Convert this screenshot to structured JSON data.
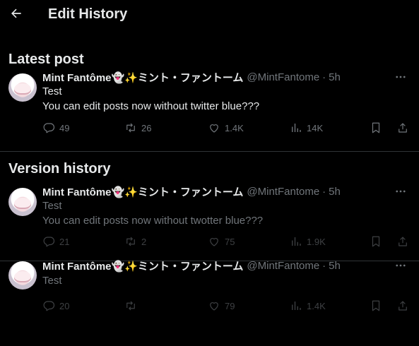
{
  "header": {
    "title": "Edit History"
  },
  "sections": {
    "latest": "Latest post",
    "version": "Version history"
  },
  "posts": [
    {
      "name": "Mint Fantôme👻✨ミント・ファントーム",
      "handle": "@MintFantome",
      "dot": "·",
      "time": "5h",
      "lines": [
        "Test",
        "You can edit posts now without twitter blue???"
      ],
      "replies": "49",
      "retweets": "26",
      "likes": "1.4K",
      "views": "14K"
    },
    {
      "name": "Mint Fantôme👻✨ミント・ファントーム",
      "handle": "@MintFantome",
      "dot": "·",
      "time": "5h",
      "lines": [
        "Test",
        "You can edit posts now without twotter blue???"
      ],
      "replies": "21",
      "retweets": "2",
      "likes": "75",
      "views": "1.9K"
    },
    {
      "name": "Mint Fantôme👻✨ミント・ファントーム",
      "handle": "@MintFantome",
      "dot": "·",
      "time": "5h",
      "lines": [
        "Test"
      ],
      "replies": "20",
      "retweets": "",
      "likes": "79",
      "views": "1.4K"
    }
  ],
  "icons": [
    "back-arrow-icon",
    "more-icon",
    "reply-icon",
    "retweet-icon",
    "like-icon",
    "views-icon",
    "bookmark-icon",
    "share-icon"
  ],
  "colors": {
    "background": "#000000",
    "text": "#e7e9ea",
    "secondary": "#71767b",
    "border": "#2f3336"
  }
}
